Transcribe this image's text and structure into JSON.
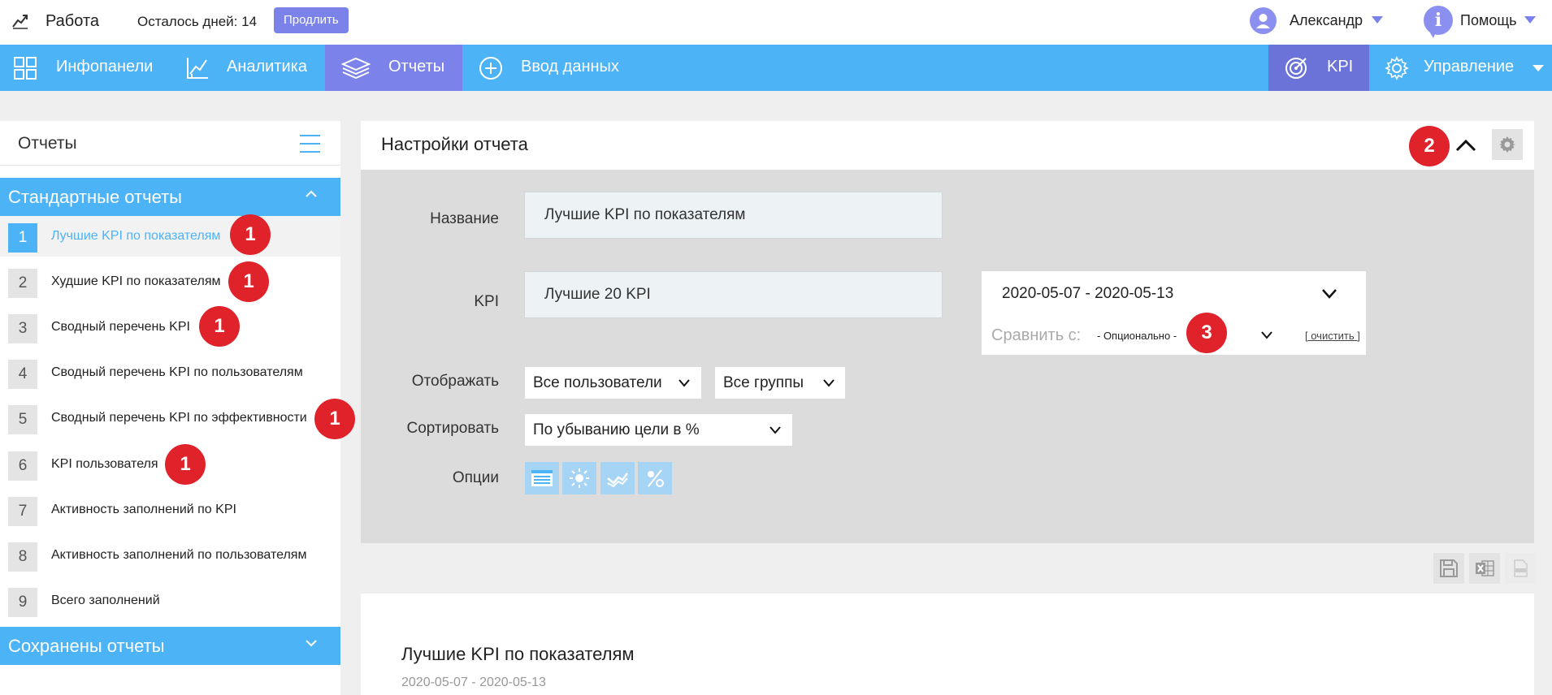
{
  "topbar": {
    "brand": "Работа",
    "days_left": "Осталось дней: 14",
    "extend_label": "Продлить",
    "user_name": "Александр",
    "help_icon": "i",
    "help_label": "Помощь"
  },
  "nav": {
    "items": [
      {
        "label": "Инфопанели",
        "icon": "grid-icon"
      },
      {
        "label": "Аналитика",
        "icon": "chart-icon"
      },
      {
        "label": "Отчеты",
        "icon": "layers-icon"
      },
      {
        "label": "Ввод данных",
        "icon": "plus-circle-icon"
      }
    ],
    "kpi_label": "KPI",
    "manage_label": "Управление"
  },
  "sidebar": {
    "title": "Отчеты",
    "standard_title": "Стандартные отчеты",
    "saved_title": "Сохранены отчеты",
    "reports": [
      {
        "num": "1",
        "name": "Лучшие KPI по показателям"
      },
      {
        "num": "2",
        "name": "Худшие KPI по показателям"
      },
      {
        "num": "3",
        "name": "Сводный перечень KPI"
      },
      {
        "num": "4",
        "name": "Сводный перечень KPI по пользователям"
      },
      {
        "num": "5",
        "name": "Сводный перечень KPI по эффективности"
      },
      {
        "num": "6",
        "name": "KPI пользователя"
      },
      {
        "num": "7",
        "name": "Активность заполнений по KPI"
      },
      {
        "num": "8",
        "name": "Активность заполнений по пользователям"
      },
      {
        "num": "9",
        "name": "Всего заполнений"
      }
    ]
  },
  "badges": {
    "one": "1",
    "two": "2",
    "three": "3"
  },
  "settings": {
    "title": "Настройки отчета",
    "name_label": "Название",
    "name_value": "Лучшие KPI по показателям",
    "kpi_label": "KPI",
    "kpi_value": "Лучшие 20 KPI",
    "date_range": "2020-05-07 - 2020-05-13",
    "compare_label": "Сравнить с:",
    "compare_value": "- Опционально -",
    "clear_label": "[ очистить ]",
    "display_label": "Отображать",
    "display_users": "Все пользователи",
    "display_groups": "Все группы",
    "sort_label": "Сортировать",
    "sort_value": "По убыванию цели в %",
    "options_label": "Опции"
  },
  "result": {
    "title": "Лучшие KPI по показателям",
    "date": "2020-05-07 - 2020-05-13"
  },
  "colors": {
    "primary": "#4db3f7",
    "accent": "#7b83eb",
    "badge": "#e0232b"
  }
}
